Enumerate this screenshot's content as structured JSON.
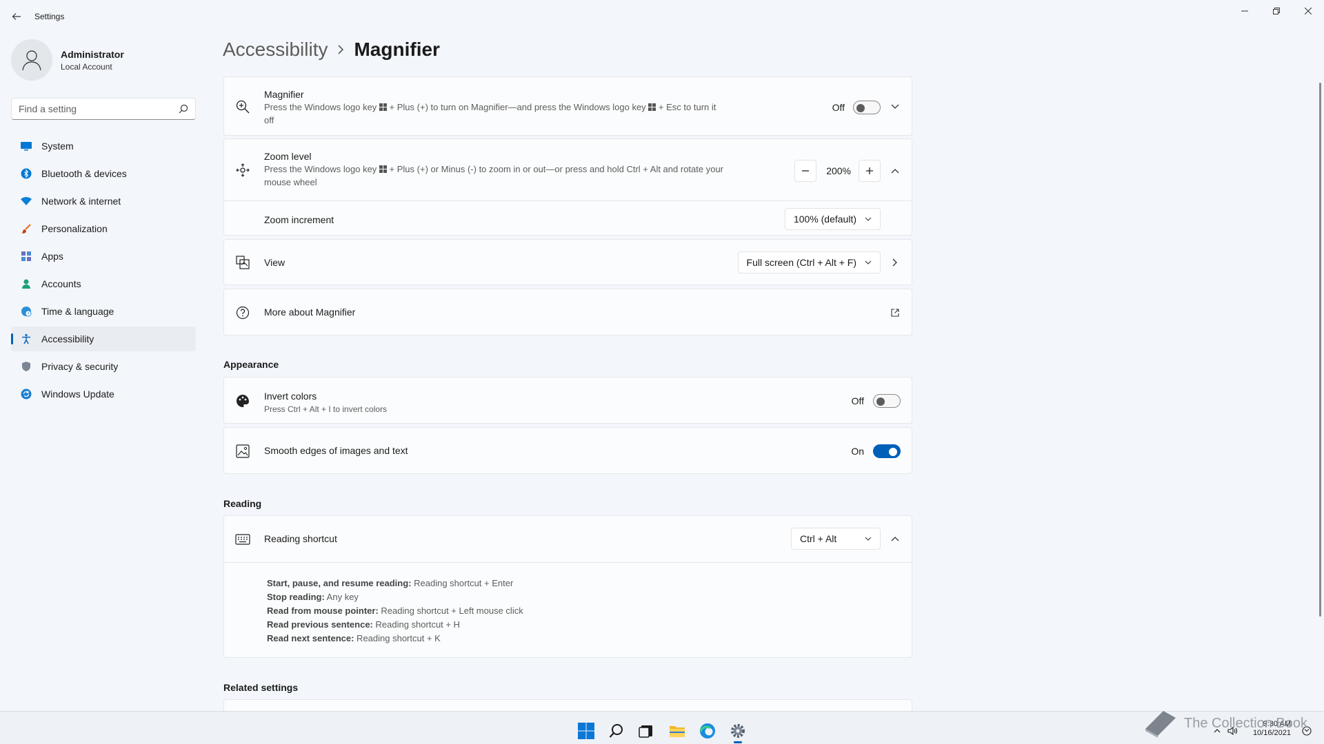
{
  "window": {
    "app_title": "Settings"
  },
  "user": {
    "name": "Administrator",
    "account_type": "Local Account"
  },
  "search": {
    "placeholder": "Find a setting"
  },
  "sidebar": {
    "items": [
      {
        "label": "System",
        "icon": "monitor-icon"
      },
      {
        "label": "Bluetooth & devices",
        "icon": "bluetooth-icon"
      },
      {
        "label": "Network & internet",
        "icon": "wifi-icon"
      },
      {
        "label": "Personalization",
        "icon": "brush-icon"
      },
      {
        "label": "Apps",
        "icon": "apps-icon"
      },
      {
        "label": "Accounts",
        "icon": "person-icon"
      },
      {
        "label": "Time & language",
        "icon": "globe-clock-icon"
      },
      {
        "label": "Accessibility",
        "icon": "accessibility-icon",
        "active": true
      },
      {
        "label": "Privacy & security",
        "icon": "shield-icon"
      },
      {
        "label": "Windows Update",
        "icon": "update-icon"
      }
    ]
  },
  "breadcrumb": {
    "parent": "Accessibility",
    "current": "Magnifier"
  },
  "magnifier": {
    "title": "Magnifier",
    "desc_part1": "Press the Windows logo key",
    "desc_part2": "+ Plus (+) to turn on Magnifier—and press the Windows logo key",
    "desc_part3": "+ Esc to turn it",
    "desc_part4": "off",
    "state_label": "Off"
  },
  "zoom": {
    "title": "Zoom level",
    "desc_part1": "Press the Windows logo key",
    "desc_part2": "+ Plus (+) or Minus (-) to zoom in or out—or press and hold Ctrl + Alt and rotate your",
    "desc_part3": "mouse wheel",
    "value": "200%",
    "increment_label": "Zoom increment",
    "increment_value": "100% (default)"
  },
  "view": {
    "title": "View",
    "value": "Full screen (Ctrl + Alt + F)"
  },
  "more": {
    "title": "More about Magnifier"
  },
  "appearance": {
    "section": "Appearance",
    "invert_title": "Invert colors",
    "invert_desc": "Press Ctrl + Alt + I to invert colors",
    "invert_state": "Off",
    "smooth_title": "Smooth edges of images and text",
    "smooth_state": "On"
  },
  "reading": {
    "section": "Reading",
    "shortcut_title": "Reading shortcut",
    "shortcut_value": "Ctrl + Alt",
    "lines": [
      {
        "bold": "Start, pause, and resume reading:",
        "text": " Reading shortcut + Enter"
      },
      {
        "bold": "Stop reading:",
        "text": " Any key"
      },
      {
        "bold": "Read from mouse pointer:",
        "text": " Reading shortcut + Left mouse click"
      },
      {
        "bold": "Read previous sentence:",
        "text": " Reading shortcut + H"
      },
      {
        "bold": "Read next sentence:",
        "text": " Reading shortcut + K"
      }
    ]
  },
  "related": {
    "section": "Related settings"
  },
  "taskbar": {
    "time": "9:30 AM",
    "date": "10/16/2021"
  },
  "watermark": {
    "text": "The Collection Book"
  },
  "colors": {
    "accent": "#005fb8",
    "background": "#f3f6fa",
    "card": "#fbfcfd"
  }
}
